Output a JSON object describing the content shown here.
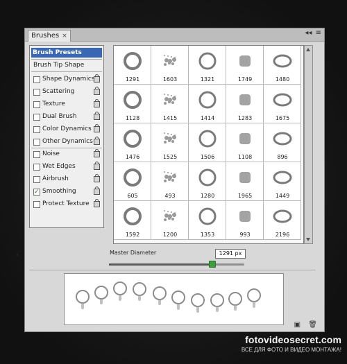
{
  "panel": {
    "tab_title": "Brushes",
    "close_symbol": "×",
    "menu_icons": [
      "collapse-icon",
      "panel-menu-icon"
    ]
  },
  "left_menu": {
    "header": "Brush Presets",
    "tip_shape": "Brush Tip Shape",
    "items": [
      {
        "label": "Shape Dynamics",
        "checked": false
      },
      {
        "label": "Scattering",
        "checked": false
      },
      {
        "label": "Texture",
        "checked": false
      },
      {
        "label": "Dual Brush",
        "checked": false
      },
      {
        "label": "Color Dynamics",
        "checked": false
      },
      {
        "label": "Other Dynamics",
        "checked": false
      },
      {
        "label": "Noise",
        "checked": false
      },
      {
        "label": "Wet Edges",
        "checked": false
      },
      {
        "label": "Airbrush",
        "checked": false
      },
      {
        "label": "Smoothing",
        "checked": true
      },
      {
        "label": "Protect Texture",
        "checked": false
      }
    ]
  },
  "brush_grid": {
    "rows": [
      [
        "1291",
        "1603",
        "1321",
        "1749",
        "1480"
      ],
      [
        "1128",
        "1415",
        "1414",
        "1283",
        "1675"
      ],
      [
        "1476",
        "1525",
        "1506",
        "1108",
        "896"
      ],
      [
        "605",
        "493",
        "1280",
        "1965",
        "1449"
      ],
      [
        "1592",
        "1200",
        "1353",
        "993",
        "2196"
      ]
    ]
  },
  "master_diameter": {
    "label": "Master Diameter",
    "value": "1291 px",
    "slider_percent": 76
  },
  "bottom_icons": [
    "new-brush-icon",
    "delete-icon"
  ],
  "watermark": {
    "site": "fotovideosecret.com",
    "tagline": "ВСЕ ДЛЯ ФОТО И ВИДЕО МОНТАЖА!"
  }
}
